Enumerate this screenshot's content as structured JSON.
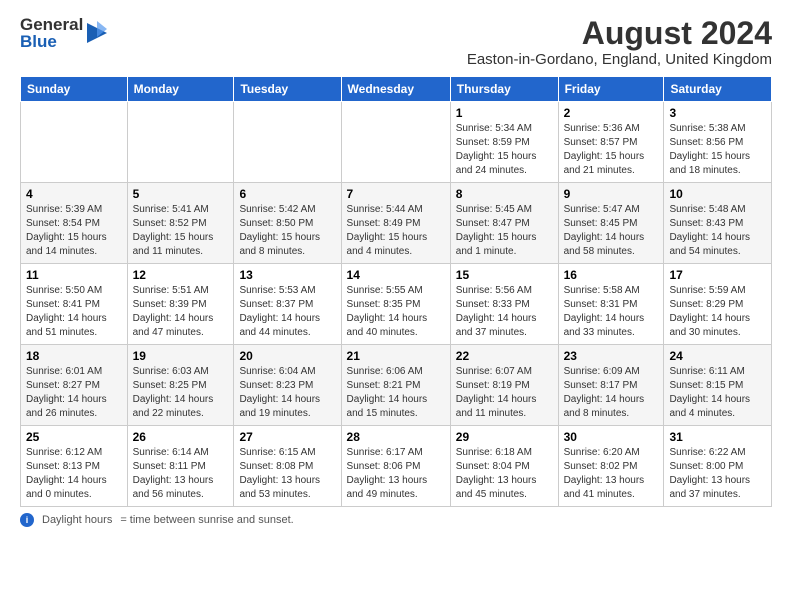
{
  "header": {
    "logo_general": "General",
    "logo_blue": "Blue",
    "main_title": "August 2024",
    "subtitle": "Easton-in-Gordano, England, United Kingdom"
  },
  "calendar": {
    "days_of_week": [
      "Sunday",
      "Monday",
      "Tuesday",
      "Wednesday",
      "Thursday",
      "Friday",
      "Saturday"
    ],
    "weeks": [
      [
        {
          "day": "",
          "info": ""
        },
        {
          "day": "",
          "info": ""
        },
        {
          "day": "",
          "info": ""
        },
        {
          "day": "",
          "info": ""
        },
        {
          "day": "1",
          "info": "Sunrise: 5:34 AM\nSunset: 8:59 PM\nDaylight: 15 hours\nand 24 minutes."
        },
        {
          "day": "2",
          "info": "Sunrise: 5:36 AM\nSunset: 8:57 PM\nDaylight: 15 hours\nand 21 minutes."
        },
        {
          "day": "3",
          "info": "Sunrise: 5:38 AM\nSunset: 8:56 PM\nDaylight: 15 hours\nand 18 minutes."
        }
      ],
      [
        {
          "day": "4",
          "info": "Sunrise: 5:39 AM\nSunset: 8:54 PM\nDaylight: 15 hours\nand 14 minutes."
        },
        {
          "day": "5",
          "info": "Sunrise: 5:41 AM\nSunset: 8:52 PM\nDaylight: 15 hours\nand 11 minutes."
        },
        {
          "day": "6",
          "info": "Sunrise: 5:42 AM\nSunset: 8:50 PM\nDaylight: 15 hours\nand 8 minutes."
        },
        {
          "day": "7",
          "info": "Sunrise: 5:44 AM\nSunset: 8:49 PM\nDaylight: 15 hours\nand 4 minutes."
        },
        {
          "day": "8",
          "info": "Sunrise: 5:45 AM\nSunset: 8:47 PM\nDaylight: 15 hours\nand 1 minute."
        },
        {
          "day": "9",
          "info": "Sunrise: 5:47 AM\nSunset: 8:45 PM\nDaylight: 14 hours\nand 58 minutes."
        },
        {
          "day": "10",
          "info": "Sunrise: 5:48 AM\nSunset: 8:43 PM\nDaylight: 14 hours\nand 54 minutes."
        }
      ],
      [
        {
          "day": "11",
          "info": "Sunrise: 5:50 AM\nSunset: 8:41 PM\nDaylight: 14 hours\nand 51 minutes."
        },
        {
          "day": "12",
          "info": "Sunrise: 5:51 AM\nSunset: 8:39 PM\nDaylight: 14 hours\nand 47 minutes."
        },
        {
          "day": "13",
          "info": "Sunrise: 5:53 AM\nSunset: 8:37 PM\nDaylight: 14 hours\nand 44 minutes."
        },
        {
          "day": "14",
          "info": "Sunrise: 5:55 AM\nSunset: 8:35 PM\nDaylight: 14 hours\nand 40 minutes."
        },
        {
          "day": "15",
          "info": "Sunrise: 5:56 AM\nSunset: 8:33 PM\nDaylight: 14 hours\nand 37 minutes."
        },
        {
          "day": "16",
          "info": "Sunrise: 5:58 AM\nSunset: 8:31 PM\nDaylight: 14 hours\nand 33 minutes."
        },
        {
          "day": "17",
          "info": "Sunrise: 5:59 AM\nSunset: 8:29 PM\nDaylight: 14 hours\nand 30 minutes."
        }
      ],
      [
        {
          "day": "18",
          "info": "Sunrise: 6:01 AM\nSunset: 8:27 PM\nDaylight: 14 hours\nand 26 minutes."
        },
        {
          "day": "19",
          "info": "Sunrise: 6:03 AM\nSunset: 8:25 PM\nDaylight: 14 hours\nand 22 minutes."
        },
        {
          "day": "20",
          "info": "Sunrise: 6:04 AM\nSunset: 8:23 PM\nDaylight: 14 hours\nand 19 minutes."
        },
        {
          "day": "21",
          "info": "Sunrise: 6:06 AM\nSunset: 8:21 PM\nDaylight: 14 hours\nand 15 minutes."
        },
        {
          "day": "22",
          "info": "Sunrise: 6:07 AM\nSunset: 8:19 PM\nDaylight: 14 hours\nand 11 minutes."
        },
        {
          "day": "23",
          "info": "Sunrise: 6:09 AM\nSunset: 8:17 PM\nDaylight: 14 hours\nand 8 minutes."
        },
        {
          "day": "24",
          "info": "Sunrise: 6:11 AM\nSunset: 8:15 PM\nDaylight: 14 hours\nand 4 minutes."
        }
      ],
      [
        {
          "day": "25",
          "info": "Sunrise: 6:12 AM\nSunset: 8:13 PM\nDaylight: 14 hours\nand 0 minutes."
        },
        {
          "day": "26",
          "info": "Sunrise: 6:14 AM\nSunset: 8:11 PM\nDaylight: 13 hours\nand 56 minutes."
        },
        {
          "day": "27",
          "info": "Sunrise: 6:15 AM\nSunset: 8:08 PM\nDaylight: 13 hours\nand 53 minutes."
        },
        {
          "day": "28",
          "info": "Sunrise: 6:17 AM\nSunset: 8:06 PM\nDaylight: 13 hours\nand 49 minutes."
        },
        {
          "day": "29",
          "info": "Sunrise: 6:18 AM\nSunset: 8:04 PM\nDaylight: 13 hours\nand 45 minutes."
        },
        {
          "day": "30",
          "info": "Sunrise: 6:20 AM\nSunset: 8:02 PM\nDaylight: 13 hours\nand 41 minutes."
        },
        {
          "day": "31",
          "info": "Sunrise: 6:22 AM\nSunset: 8:00 PM\nDaylight: 13 hours\nand 37 minutes."
        }
      ]
    ]
  },
  "footer": {
    "note": "Daylight hours"
  }
}
